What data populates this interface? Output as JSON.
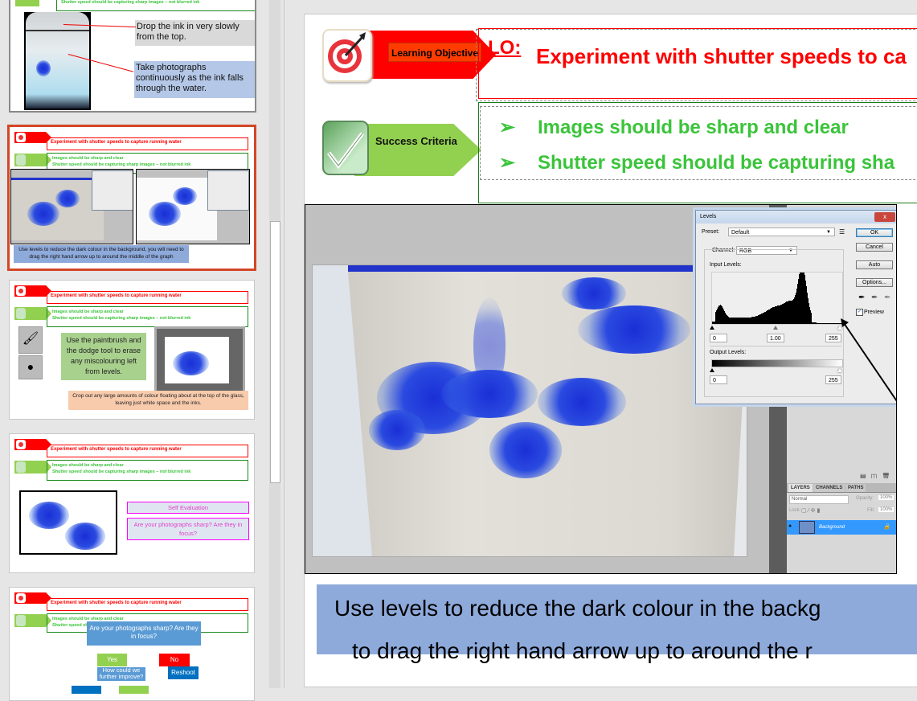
{
  "thumbnails": [
    {
      "id": "prev-slide-partial",
      "header_sc_text": "Shutter speed should be capturing sharp images – not blurred ink",
      "notes": [
        "Drop the ink in very slowly from the top.",
        "Take photographs continuously as the ink falls through the water."
      ]
    },
    {
      "id": "current-slide",
      "selected": true,
      "lo_text": "Experiment with shutter speeds to capture running water",
      "sc_items": [
        "Images should be sharp and clear",
        "Shutter speed should be capturing sharp images – not blurred ink"
      ],
      "caption": "Use levels to reduce the dark colour in the background, you will need to drag the right hand arrow up to around the middle of the graph"
    },
    {
      "id": "slide-dodge",
      "lo_text": "Experiment with shutter speeds to capture running water",
      "sc_items": [
        "Images should be sharp and clear",
        "Shutter speed should be capturing sharp images – not blurred ink"
      ],
      "note_green": "Use the paintbrush and the dodge tool to erase any miscolouring left from levels.",
      "note_orange": "Crop out any large amounts of colour floating about at the top of the glass, leaving just white space and the inks."
    },
    {
      "id": "slide-self-eval",
      "lo_text": "Experiment with shutter speeds to capture running water",
      "sc_items": [
        "Images should be sharp and clear",
        "Shutter speed should be capturing sharp images – not blurred ink"
      ],
      "eval_title": "Self Evaluation",
      "eval_question": "Are your photographs sharp? Are they in focus?"
    },
    {
      "id": "slide-flowchart",
      "lo_text": "Experiment with shutter speeds to capture running water",
      "sc_items": [
        "Images should be sharp and clear",
        "Shutter speed should be capturing sharp images – not blurred ink"
      ],
      "flow_question": "Are your photographs sharp? Are they in focus?",
      "flow_yes": "Yes",
      "flow_no": "No",
      "flow_improve": "How could we further improve?",
      "flow_reshoot": "Reshoot"
    }
  ],
  "slide": {
    "lo_label": "Learning Objective",
    "sc_label": "Success Criteria",
    "lo_prefix": "LO:",
    "lo_text": "Experiment with shutter speeds to ca",
    "sc_bullet": "➢",
    "sc_items": [
      "Images should be sharp and clear",
      "Shutter speed should be capturing sha"
    ],
    "caption_line1": "Use levels to reduce the dark colour in the backg",
    "caption_line2": "to drag the right hand arrow up to around the r",
    "levels_dialog": {
      "title": "Levels",
      "close": "x",
      "preset_label": "Preset:",
      "preset_value": "Default",
      "channel_label": "Channel:",
      "channel_value": "RGB",
      "input_levels_label": "Input Levels:",
      "input_black": "0",
      "input_gamma": "1.00",
      "input_white": "255",
      "output_levels_label": "Output Levels:",
      "output_black": "0",
      "output_white": "255",
      "buttons": [
        "OK",
        "Cancel",
        "Auto",
        "Options..."
      ],
      "preview_label": "Preview",
      "preview_checked": true
    },
    "layers_panel": {
      "tabs": [
        "LAYERS",
        "CHANNELS",
        "PATHS"
      ],
      "blend_mode": "Normal",
      "opacity_label": "Opacity:",
      "opacity_value": "100%",
      "lock_label": "Lock:",
      "fill_label": "Fill:",
      "fill_value": "100%",
      "layer_name": "Background"
    }
  },
  "colors": {
    "lo_red": "#ff0000",
    "sc_green": "#3ac43a",
    "selected_border": "#d24726",
    "caption_bg": "#8eaadb",
    "layer_highlight": "#3399ff"
  }
}
